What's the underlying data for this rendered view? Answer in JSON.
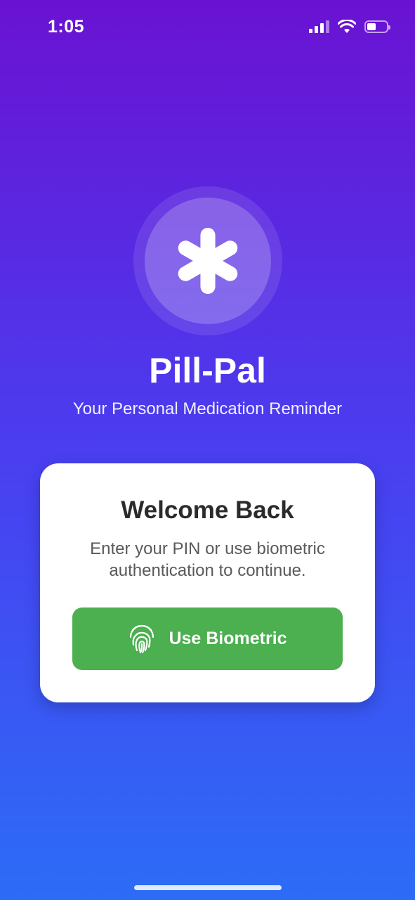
{
  "status_bar": {
    "time": "1:05",
    "battery_level_percent": 45,
    "icons": [
      "signal-icon",
      "wifi-icon",
      "battery-icon"
    ]
  },
  "app": {
    "logo_icon": "asterisk-icon",
    "title": "Pill-Pal",
    "subtitle": "Your Personal Medication Reminder"
  },
  "login_card": {
    "title": "Welcome Back",
    "description": "Enter your PIN or use biometric authentication to continue.",
    "biometric_button": {
      "label": "Use Biometric",
      "icon": "fingerprint-icon"
    }
  },
  "colors": {
    "background_top": "#6a12d2",
    "background_bottom": "#2c6cf6",
    "button": "#4caf50",
    "card": "#ffffff",
    "card_title": "#2b2b2b",
    "card_text": "#5a5a5a"
  }
}
